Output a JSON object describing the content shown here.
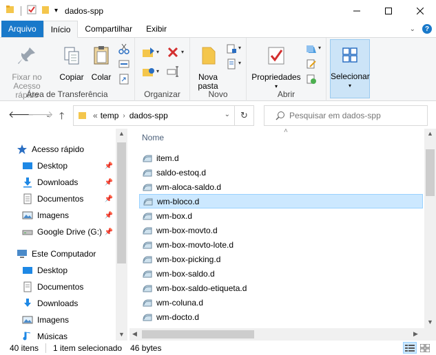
{
  "window": {
    "title": "dados-spp"
  },
  "tabs": {
    "file": "Arquivo",
    "home": "Início",
    "share": "Compartilhar",
    "view": "Exibir"
  },
  "ribbon": {
    "pin_quick_access": [
      "Fixar no",
      "Acesso rápido"
    ],
    "copy": "Copiar",
    "paste": "Colar",
    "clipboard_group": "Área de Transferência",
    "organize_group": "Organizar",
    "new_folder": [
      "Nova",
      "pasta"
    ],
    "new_group": "Novo",
    "properties": "Propriedades",
    "open_group": "Abrir",
    "select": "Selecionar"
  },
  "address": {
    "overflow": "«",
    "crumbs": [
      "temp",
      "dados-spp"
    ]
  },
  "search": {
    "placeholder": "Pesquisar em dados-spp"
  },
  "navpane": {
    "quick_access": "Acesso rápido",
    "items": [
      {
        "label": "Desktop",
        "icon": "desktop-icon",
        "pinned": true
      },
      {
        "label": "Downloads",
        "icon": "downloads-icon",
        "pinned": true
      },
      {
        "label": "Documentos",
        "icon": "documents-icon",
        "pinned": true
      },
      {
        "label": "Imagens",
        "icon": "pictures-icon",
        "pinned": true
      },
      {
        "label": "Google Drive (G:)",
        "icon": "drive-icon",
        "pinned": true
      }
    ],
    "this_pc": "Este Computador",
    "pc_items": [
      {
        "label": "Desktop",
        "icon": "desktop-icon"
      },
      {
        "label": "Documentos",
        "icon": "documents-icon"
      },
      {
        "label": "Downloads",
        "icon": "downloads-icon"
      },
      {
        "label": "Imagens",
        "icon": "pictures-icon"
      },
      {
        "label": "Músicas",
        "icon": "music-icon"
      }
    ]
  },
  "filelist": {
    "column_name": "Nome",
    "files": [
      "item.d",
      "saldo-estoq.d",
      "wm-aloca-saldo.d",
      "wm-bloco.d",
      "wm-box.d",
      "wm-box-movto.d",
      "wm-box-movto-lote.d",
      "wm-box-picking.d",
      "wm-box-saldo.d",
      "wm-box-saldo-etiqueta.d",
      "wm-coluna.d",
      "wm-docto.d"
    ],
    "selected_index": 3
  },
  "status": {
    "count": "40 itens",
    "selection": "1 item selecionado",
    "size": "46 bytes"
  },
  "colors": {
    "accent": "#1979ca",
    "selection_bg": "#cce8ff",
    "selection_border": "#99d1ff"
  }
}
